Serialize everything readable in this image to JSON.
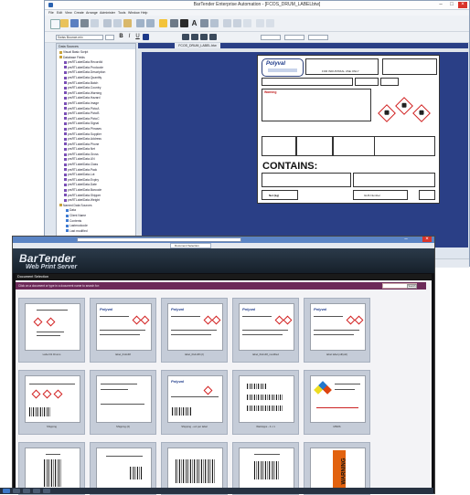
{
  "designer": {
    "title": "BarTender Enterprise Automation - [FCOS_DRUM_LABELbtw]",
    "menu": [
      "File",
      "Edit",
      "View",
      "Create",
      "Arrange",
      "Administer",
      "Tools",
      "Window",
      "Help"
    ],
    "font_select": "Swiss Bounce-mix",
    "data_sources_title": "Data Sources",
    "tree": [
      "Visual Basic Script",
      "Database Fields",
      "prsRTLabelData.RecordId",
      "prsRTLabelData.Prodcode",
      "prsRTLabelData.Description",
      "prsRTLabelData.Quantity",
      "prsRTLabelData.Batch",
      "prsRTLabelData.Country",
      "prsRTLabelData.Warning",
      "prsRTLabelData.Hazard",
      "prsRTLabelData.Image",
      "prsRTLabelData.PictoA",
      "prsRTLabelData.PictoB",
      "prsRTLabelData.PictoC",
      "prsRTLabelData.Signal",
      "prsRTLabelData.Phrases",
      "prsRTLabelData.Supplier",
      "prsRTLabelData.Address",
      "prsRTLabelData.Phone",
      "prsRTLabelData.Net",
      "prsRTLabelData.Gross",
      "prsRTLabelData.UN",
      "prsRTLabelData.Class",
      "prsRTLabelData.Pack",
      "prsRTLabelData.Lot",
      "prsRTLabelData.Expiry",
      "prsRTLabelData.Date",
      "prsRTLabelData.Barcode",
      "prsRTLabelData.Shipper",
      "prsRTLabelData.Weight",
      "Named Data Sources",
      "Data",
      "Client Name",
      "Contents",
      "Lastmodcode",
      "Last modified"
    ],
    "doc_tab": "FCOS_DRUM_LABEL.btw",
    "label": {
      "logo": "Polyval",
      "title": "FOR INDUSTRIAL USE ONLY",
      "warning": "Warning",
      "contains": "CONTAINS:",
      "net": "Net (kg)",
      "ghs": "GHS Number"
    }
  },
  "webprint": {
    "browser_tab": "Document Selection",
    "brand_line1": "BarTender",
    "brand_line2": "Web Print Server",
    "section_title": "Document Selection",
    "hint": "Click on a document or type in a document name to search for:",
    "search_button": "Search",
    "cards": [
      {
        "caption": "Label 01 Drums"
      },
      {
        "caption": "label_01dx48"
      },
      {
        "caption": "label_01dx48 (2)"
      },
      {
        "caption": "label_01dx48_modified"
      },
      {
        "caption": "label label pdf(old)"
      },
      {
        "caption": "Shipping"
      },
      {
        "caption": "Shipping (2)"
      },
      {
        "caption": "Shipping - ext per label"
      },
      {
        "caption": "WebApps - 4 x 1"
      },
      {
        "caption": "MSDS"
      },
      {
        "caption": ""
      },
      {
        "caption": ""
      },
      {
        "caption": ""
      },
      {
        "caption": ""
      },
      {
        "caption": "WARNING"
      }
    ]
  },
  "colors": {
    "designer_canvas": "#2a3f86",
    "hint_bar": "#6c2a59",
    "hazard_red": "#d01e1e"
  }
}
